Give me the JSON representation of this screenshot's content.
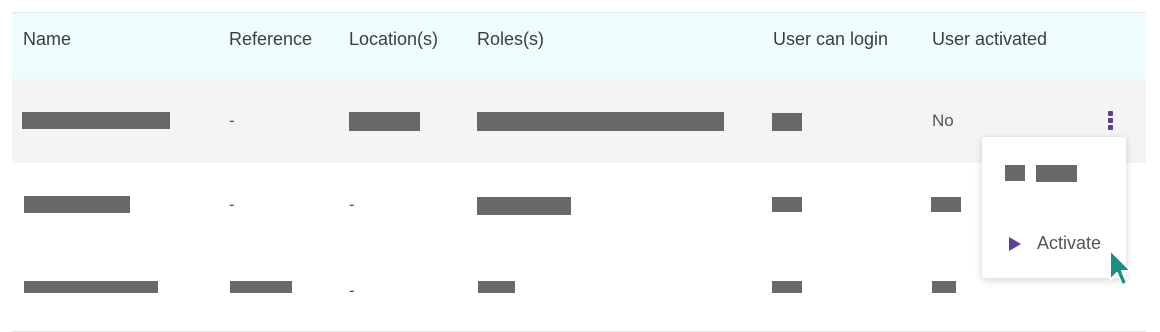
{
  "table": {
    "columns": [
      "Name",
      "Reference",
      "Location(s)",
      "Roles(s)",
      "User can login",
      "User activated"
    ],
    "rows": [
      {
        "reference": "-",
        "location": "",
        "user_activated": "No"
      },
      {
        "reference": "-",
        "location": "-",
        "user_activated": ""
      },
      {
        "reference": "",
        "location": "-",
        "user_activated": ""
      }
    ]
  },
  "row_menu": {
    "items": [
      {
        "label": ""
      },
      {
        "label": "Activate",
        "icon": "play-icon"
      }
    ]
  },
  "colors": {
    "accent": "#5b3e9b",
    "header_bg": "#effcfd",
    "cursor": "#1a8f86",
    "redaction": "#686868"
  }
}
